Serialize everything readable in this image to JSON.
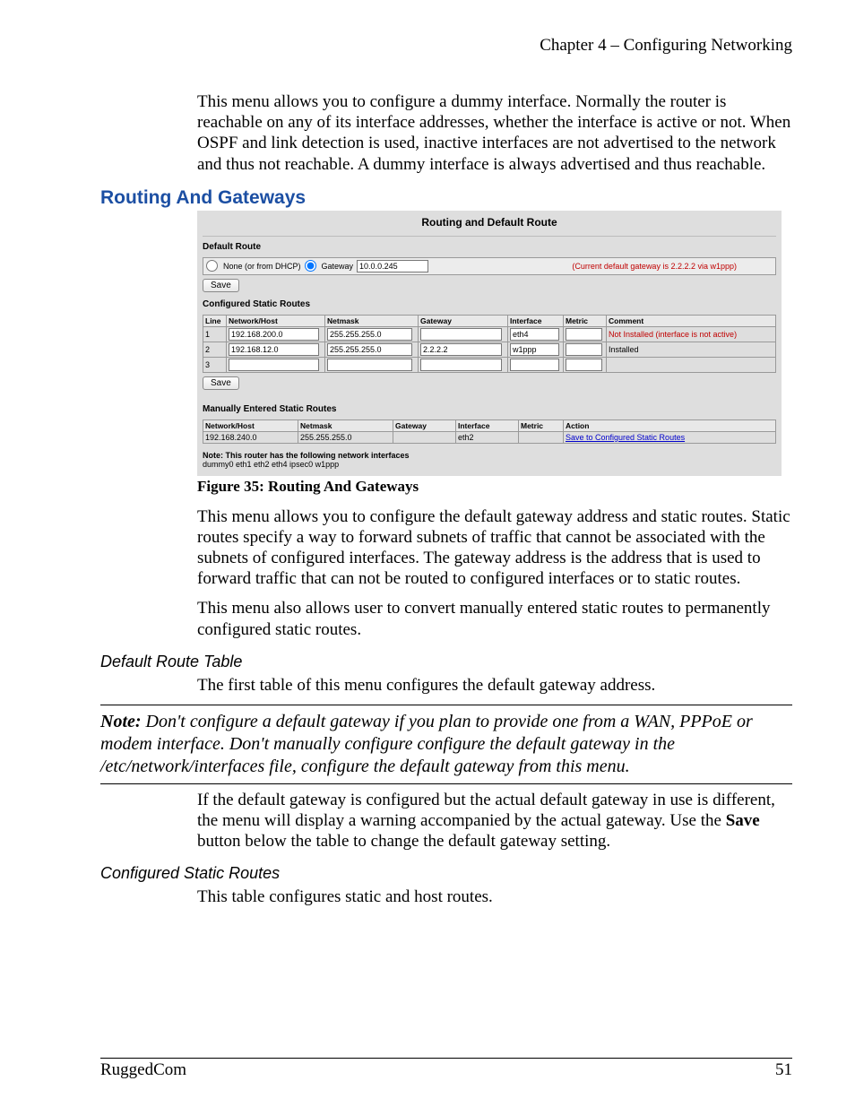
{
  "header": {
    "chapter": "Chapter 4 – Configuring Networking"
  },
  "intro_para": "This menu allows you to configure a dummy interface.  Normally the router is reachable on any of its interface addresses, whether the interface is active or not.  When OSPF and link detection is used, inactive interfaces are not advertised to the network and thus not reachable.  A dummy interface is always advertised and thus reachable.",
  "section_title": "Routing And Gateways",
  "figure": {
    "panel_title": "Routing and Default Route",
    "default_route": {
      "heading": "Default Route",
      "opt_none_label": "None (or from DHCP)",
      "opt_gateway_label": "Gateway",
      "gateway_value": "10.0.0.245",
      "status": "(Current default gateway is 2.2.2.2 via w1ppp)",
      "save_label": "Save"
    },
    "csr": {
      "heading": "Configured Static Routes",
      "cols": [
        "Line",
        "Network/Host",
        "Netmask",
        "Gateway",
        "Interface",
        "Metric",
        "Comment"
      ],
      "rows": [
        {
          "line": "1",
          "net": "192.168.200.0",
          "mask": "255.255.255.0",
          "gw": "",
          "if": "eth4",
          "metric": "",
          "comment": "Not Installed (interface is not active)",
          "comment_class": "red"
        },
        {
          "line": "2",
          "net": "192.168.12.0",
          "mask": "255.255.255.0",
          "gw": "2.2.2.2",
          "if": "w1ppp",
          "metric": "",
          "comment": "Installed",
          "comment_class": ""
        },
        {
          "line": "3",
          "net": "",
          "mask": "",
          "gw": "",
          "if": "",
          "metric": "",
          "comment": "",
          "comment_class": ""
        }
      ],
      "save_label": "Save"
    },
    "mesr": {
      "heading": "Manually Entered Static Routes",
      "cols": [
        "Network/Host",
        "Netmask",
        "Gateway",
        "Interface",
        "Metric",
        "Action"
      ],
      "row": {
        "net": "192.168.240.0",
        "mask": "255.255.255.0",
        "gw": "",
        "if": "eth2",
        "metric": "",
        "action": "Save to Configured Static Routes"
      }
    },
    "note_line1": "Note: This router has the following network interfaces",
    "note_line2": "dummy0 eth1 eth2 eth4 ipsec0 w1ppp",
    "caption": "Figure 35: Routing And Gateways"
  },
  "body2": "This menu allows you to configure the default gateway address and static routes.  Static routes specify a way to forward subnets of traffic that cannot be associated with the subnets of configured interfaces.  The gateway address is the address that is used to forward traffic that can not be routed to configured interfaces or to static routes.",
  "body3": "This menu also allows user to convert manually entered static routes to permanently configured static routes.",
  "sub1_title": "Default Route Table",
  "sub1_body": "The first table of this menu configures the default gateway address.",
  "note_block": {
    "prefix": "Note:",
    "text": "  Don't configure a default gateway if you plan to provide one from a WAN, PPPoE or modem interface.  Don't manually configure configure the default gateway in the /etc/network/interfaces file, configure the default gateway from this menu."
  },
  "sub1_body2_pre": "If the default gateway is configured but the actual default gateway in use is different, the menu will display a warning accompanied by the actual gateway.  Use the ",
  "sub1_body2_bold": "Save",
  "sub1_body2_post": " button below the table to change the default gateway setting.",
  "sub2_title": "Configured Static Routes",
  "sub2_body": "This table configures static and host routes.",
  "footer": {
    "left": "RuggedCom",
    "right": "51"
  }
}
